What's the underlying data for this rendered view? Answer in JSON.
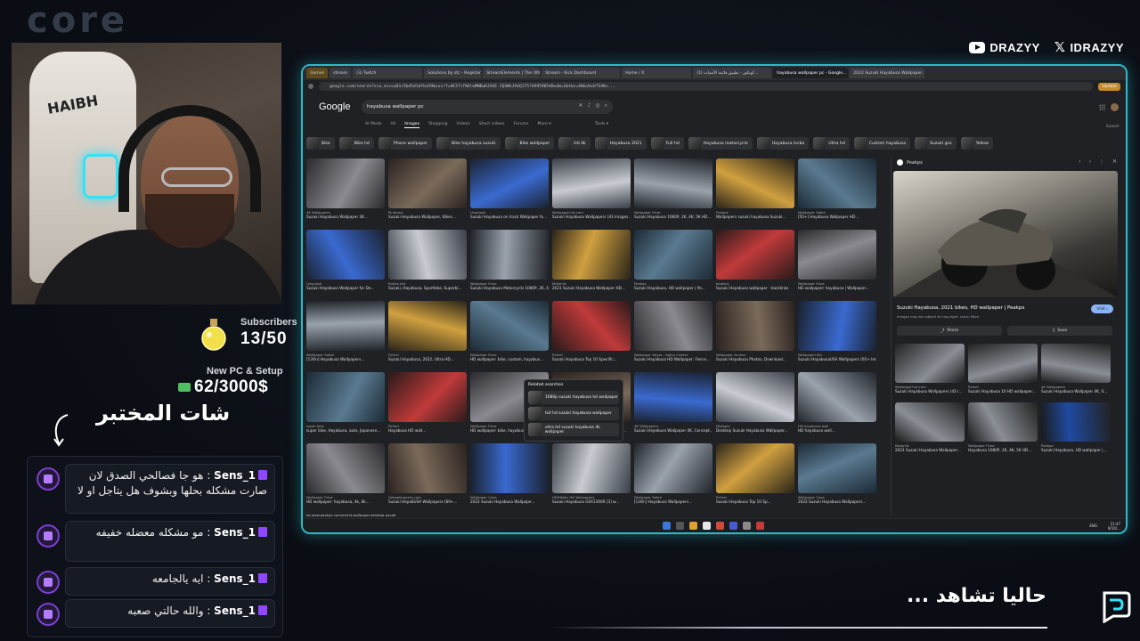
{
  "watermark": {
    "text": "core"
  },
  "socials": [
    {
      "icon": "youtube-icon",
      "handle": "DRAZYY"
    },
    {
      "icon": "x-icon",
      "handle": "IDRAZYY"
    }
  ],
  "webcam": {
    "chair_brand": "HAIBH"
  },
  "goals": {
    "subscribers": {
      "label": "Subscribers",
      "value": "13/50"
    },
    "pc": {
      "label": "New PC & Setup",
      "value": "62/3000$"
    }
  },
  "chat": {
    "title": "شات المختبر",
    "messages": [
      {
        "user": "1_Sens",
        "text": "هو جا فصالحي الصدق لان صارت مشكله بحلها وبشوف هل يتاجل او لا"
      },
      {
        "user": "1_Sens",
        "text": "مو مشكله معضله خفيفه"
      },
      {
        "user": "1_Sens",
        "text": "ايه يالجامعه"
      },
      {
        "user": "1_Sens",
        "text": "والله حالتي صعبه"
      }
    ]
  },
  "browser": {
    "tabs": [
      {
        "label": "Games"
      },
      {
        "label": "stream"
      },
      {
        "label": "(3) Twitch"
      },
      {
        "label": "Solutions by stc - Register Saudi Do..."
      },
      {
        "label": "StreamElements | The Ultimate Strea..."
      },
      {
        "label": "Stream - Kick Dashboard"
      },
      {
        "label": "Home / X"
      },
      {
        "label": "(1) كونكور - تطبيق قائمة الأمنيات..."
      },
      {
        "label": "hayabusa wallpaper pc - Google..."
      },
      {
        "label": "2022 Suzuki Hayabusa Wallpaper..."
      }
    ],
    "url": "google.com/search?sca_esv=a81c5bd5d1dfba59&sxsrf=AE3TifN4lwMNDwRJSVE-IQXWhJXGQ1757499590548udm=2&tbs=AB&iHvU7SXKs...",
    "update_label": "Update",
    "google": {
      "logo": "Google",
      "query": "hayabusa wallpaper pc",
      "tabs": [
        "AI Mode",
        "All",
        "Images",
        "Shopping",
        "Videos",
        "Short videos",
        "Forums",
        "More ▾"
      ],
      "active_tab": "Images",
      "tools": "Tools ▾",
      "saved": "Saved"
    },
    "chips": [
      "Bike",
      "Bike hd",
      "Phone wallpaper",
      "Bike hayabusa suzuki",
      "Bike wallpaper",
      "Hd 4k",
      "Hayabusa 2021",
      "Full hd",
      "Hayabusa motorcycle",
      "Hayabusa turbo",
      "Ultra hd",
      "Custom hayabusa",
      "Suzuki gsx",
      "Yellow"
    ],
    "images": [
      {
        "src": "4K Wallpapers",
        "title": "Suzuki Hayabusa Wallpaper 4K..."
      },
      {
        "src": "Pinterest",
        "title": "Suzuki Hayabusa Wallpaper, Bikes..."
      },
      {
        "src": "Unsplash",
        "title": "Suzuki Hayabusa on track Wallpaper fo..."
      },
      {
        "src": "WallpaperCat.com",
        "title": "Suzuki Hayabusa Wallpapers (43 images..."
      },
      {
        "src": "Wallpaper Flare",
        "title": "Suzuki Hayabusa 1080P, 2K, 4K, 5K HD..."
      },
      {
        "src": "Freepik",
        "title": "Wallpapers suzuki hayabusa Suzuki..."
      },
      {
        "src": "Wallpaper Safari",
        "title": "[50+] Hayabusa Wallpaper HD..."
      },
      {
        "src": "Unsplash",
        "title": "Suzuki Hayabusa Wallpaper for De..."
      },
      {
        "src": "Rakhe.net",
        "title": "Suzuki, Hayabusa, Sportbike, Superbi..."
      },
      {
        "src": "Wallpaper Flare",
        "title": "Suzuki Hayabusa Motorcycle 1080P, 2K, 4K, 5..."
      },
      {
        "src": "Motorrik",
        "title": "2021 Suzuki Hayabusa Wallpaper HD..."
      },
      {
        "src": "Peakpx",
        "title": "Suzuki Hayabusa, HD wallpaper | Pe..."
      },
      {
        "src": "bookies",
        "title": "Suzuki Hayabusa wallpaper - backlinks"
      },
      {
        "src": "Wallpaper Flare",
        "title": "HD wallpaper: hayabusa | Wallpaper..."
      },
      {
        "src": "Wallpaper Safari",
        "title": "[13On] Hayabusa Wallpapers..."
      },
      {
        "src": "Pxfuel",
        "title": "Suzuki Hayabusa, 2022, Ultra HD..."
      },
      {
        "src": "Wallpaper Flare",
        "title": "HD wallpaper: bike, custom, hayabus..."
      },
      {
        "src": "Pxfuel",
        "title": "Suzuki Hayabusa Top 10 Specific..."
      },
      {
        "src": "Wallpaper Abyss - Alpha Coders",
        "title": "Suzuki Hayabusa HD Wallpaper: Fierce..."
      },
      {
        "src": "Wallpaper Access",
        "title": "Suzuki Hayabusa Photos, Download..."
      },
      {
        "src": "WallpaperUSA",
        "title": "Suzuki HayabusaUSA Wallpapers (65+ Images)"
      },
      {
        "src": "super bike",
        "title": "super bike, Hayabusa, auto, Japanese..."
      },
      {
        "src": "Pxfuel",
        "title": "Hayabusa HD wall..."
      },
      {
        "src": "Wallpaper Flare",
        "title": "HD wallpaper: bike, hayabusa, motorbike..."
      },
      {
        "src": "Pxfuel",
        "title": "Suzuki Hayabusa Top 10 Specification..."
      },
      {
        "src": "4K Wallpapers",
        "title": "Suzuki Hayabusa Wallpaper 4K, Concept..."
      },
      {
        "src": "Wallsplx",
        "title": "Desktop Suzuki Hayabusa Wallpaper..."
      },
      {
        "src": "HD hayabusa wall",
        "title": "HD hayabusa wall..."
      },
      {
        "src": "Wallpaper Flare",
        "title": "HD wallpaper: hayabusa, 4k, 6k..."
      },
      {
        "src": "Getwallpapers.com",
        "title": "Suzuki HayabUSA Wallpapers (69+..."
      },
      {
        "src": "Wallpaper Cave",
        "title": "2022 Suzuki Hayabusa Wallpape..."
      },
      {
        "src": "HDXWallz HD Wallpapers",
        "title": "Suzuki Hayabusa GSX1300R [3] w..."
      },
      {
        "src": "Wallpaper Safari",
        "title": "[13On] Hayabusa Wallpapers..."
      },
      {
        "src": "Pxfuel",
        "title": "Suzuki Hayabusa Top 10 Sp..."
      },
      {
        "src": "Wallpaper Cave",
        "title": "2022 Suzuki Hayabusa Wallpapers..."
      }
    ],
    "status_url": "ko.www.peakpx.com/en/hd-wallpaper-desktop-oovdo",
    "related": {
      "title": "Related searches",
      "items": [
        "1080p suzuki hayabusa hd wallpaper",
        "full hd suzuki hayabusa wallpaper",
        "ultra hd suzuki hayabusa 4k wallpaper"
      ]
    },
    "preview": {
      "source": "Peakpx",
      "title": "Suzuki Hayabusa, 2021 bikes, HD wallpaper | Peakpx",
      "note": "Images may be subject to copyright. Learn More",
      "visit": "Visit ›",
      "share": "Share",
      "save": "Save",
      "grid": [
        {
          "src": "WallpaperCat.com",
          "title": "Suzuki Hayabusa Wallpapers (43 i..."
        },
        {
          "src": "Pxfuel",
          "title": "Suzuki Hayabusa 10 HD wallpaper..."
        },
        {
          "src": "4K Wallpapers",
          "title": "Suzuki Hayabusa Wallpaper 4K, S..."
        },
        {
          "src": "Motorrik",
          "title": "2021 Suzuki Hayabusa Wallpaper..."
        },
        {
          "src": "Wallpaper Flare",
          "title": "Hayabusa 1080P, 2K, 4K, 5K HD..."
        },
        {
          "src": "Peakpx",
          "title": "Suzuki Hayabusa, HD wallpaper |..."
        }
      ]
    },
    "taskbar": {
      "time": "21:47",
      "date": "9/10/...",
      "lang": "ENG"
    }
  },
  "overlay": {
    "now_watching": "حاليا تشاهد ..."
  }
}
